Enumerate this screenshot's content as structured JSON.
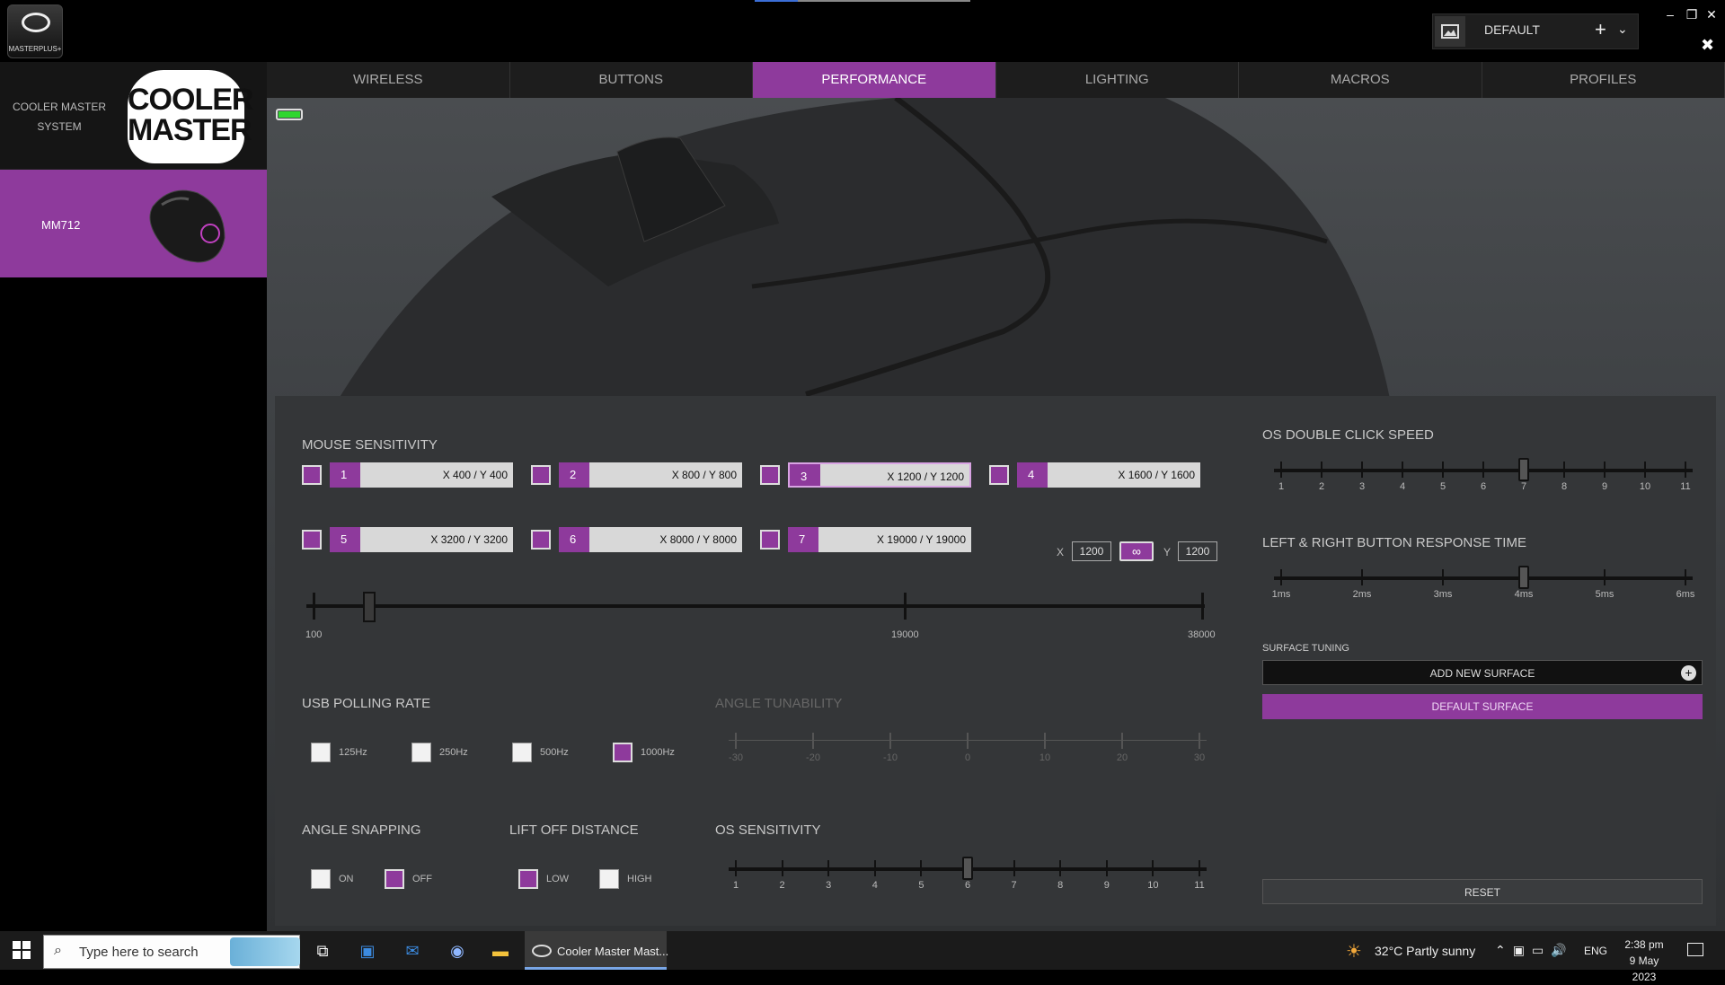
{
  "app": {
    "badge": "MASTERPLUS+"
  },
  "profile": {
    "name": "DEFAULT",
    "add": "+",
    "chevron": "⌄"
  },
  "window": {
    "minimize": "–",
    "restore": "❐",
    "close": "✕",
    "close2": "✖"
  },
  "sidebar": {
    "system_label": "COOLER MASTER SYSTEM",
    "logo_text": "COOLER MASTER",
    "device_name": "MM712"
  },
  "tabs": [
    {
      "label": "WIRELESS"
    },
    {
      "label": "BUTTONS"
    },
    {
      "label": "PERFORMANCE",
      "active": true
    },
    {
      "label": "LIGHTING"
    },
    {
      "label": "MACROS"
    },
    {
      "label": "PROFILES"
    }
  ],
  "sensitivity": {
    "title": "MOUSE SENSITIVITY",
    "presets": [
      {
        "n": "1",
        "value": "X 400 / Y 400"
      },
      {
        "n": "2",
        "value": "X 800 / Y 800"
      },
      {
        "n": "3",
        "value": "X 1200 / Y 1200",
        "selected": true
      },
      {
        "n": "4",
        "value": "X 1600 / Y 1600"
      },
      {
        "n": "5",
        "value": "X 3200 / Y 3200"
      },
      {
        "n": "6",
        "value": "X 8000 / Y 8000"
      },
      {
        "n": "7",
        "value": "X 19000 / Y 19000"
      }
    ],
    "x_label": "X",
    "x_value": "1200",
    "y_label": "Y",
    "y_value": "1200",
    "slider": {
      "min": "100",
      "mid": "19000",
      "max": "38000",
      "value": 1200
    }
  },
  "polling": {
    "title": "USB POLLING RATE",
    "options": [
      {
        "label": "125Hz",
        "checked": false
      },
      {
        "label": "250Hz",
        "checked": false
      },
      {
        "label": "500Hz",
        "checked": false
      },
      {
        "label": "1000Hz",
        "checked": true
      }
    ]
  },
  "angle_tunability": {
    "title": "ANGLE TUNABILITY",
    "ticks": [
      "-30",
      "-20",
      "-10",
      "0",
      "10",
      "20",
      "30"
    ]
  },
  "angle_snapping": {
    "title": "ANGLE SNAPPING",
    "on": "ON",
    "off": "OFF",
    "value": "OFF"
  },
  "lift_off": {
    "title": "LIFT OFF DISTANCE",
    "low": "LOW",
    "high": "HIGH",
    "value": "LOW"
  },
  "os_sensitivity": {
    "title": "OS SENSITIVITY",
    "ticks": [
      "1",
      "2",
      "3",
      "4",
      "5",
      "6",
      "7",
      "8",
      "9",
      "10",
      "11"
    ],
    "value": 6
  },
  "double_click": {
    "title": "OS DOUBLE CLICK SPEED",
    "ticks": [
      "1",
      "2",
      "3",
      "4",
      "5",
      "6",
      "7",
      "8",
      "9",
      "10",
      "11"
    ],
    "value": 7
  },
  "response_time": {
    "title": "LEFT & RIGHT BUTTON RESPONSE TIME",
    "ticks": [
      "1ms",
      "2ms",
      "3ms",
      "4ms",
      "5ms",
      "6ms"
    ],
    "value": "4ms"
  },
  "surface": {
    "title": "SURFACE TUNING",
    "add": "ADD NEW SURFACE",
    "default": "DEFAULT SURFACE"
  },
  "reset": "RESET",
  "taskbar": {
    "search_placeholder": "Type here to search",
    "app_label": "Cooler Master Mast...",
    "weather": "32°C  Partly sunny",
    "lang": "ENG",
    "time": "2:38 pm",
    "date": "9 May 2023"
  }
}
